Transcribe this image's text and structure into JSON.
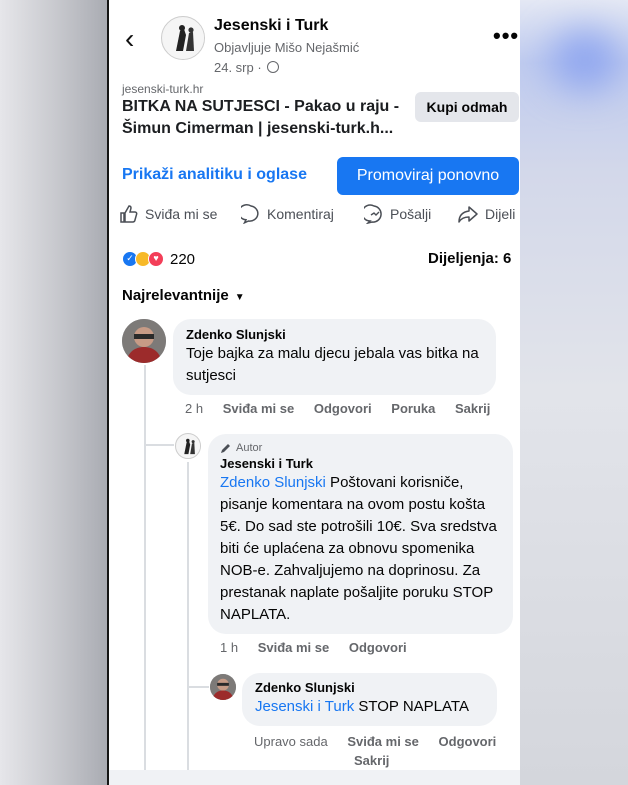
{
  "post_header": {
    "page_name": "Jesenski i Turk",
    "published_by": "Objavljuje Mišo Nejašmić",
    "date": "24. srp"
  },
  "link_preview": {
    "domain": "jesenski-turk.hr",
    "title": "BITKA NA SUTJESCI - Pakao u raju - Šimun Cimerman | jesenski-turk.h...",
    "cta": "Kupi odmah"
  },
  "admin": {
    "analytics": "Prikaži analitiku i oglase",
    "promote": "Promoviraj ponovno"
  },
  "actions": {
    "like": "Sviđa mi se",
    "comment": "Komentiraj",
    "send": "Pošalji",
    "share": "Dijeli"
  },
  "stats": {
    "reactions_count": "220",
    "shares": "Dijeljenja: 6"
  },
  "sort_label": "Najrelevantnije",
  "comments": [
    {
      "author": "Zdenko Slunjski",
      "text": "Toje bajka za malu djecu jebala vas bitka na sutjesci",
      "time": "2 h",
      "actions": [
        "Sviđa mi se",
        "Odgovori",
        "Poruka",
        "Sakrij"
      ]
    },
    {
      "badge": "Autor",
      "author": "Jesenski i Turk",
      "mention": "Zdenko Slunjski",
      "text": " Poštovani korisniče, pisanje komentara na ovom postu košta 5€. Do sad ste potrošili 10€. Sva sredstva biti će uplaćena za obnovu spomenika NOB-e. Zahvaljujemo na doprinosu. Za prestanak naplate pošaljite poruku STOP NAPLATA.",
      "time": "1 h",
      "actions": [
        "Sviđa mi se",
        "Odgovori"
      ]
    },
    {
      "author": "Zdenko Slunjski",
      "mention": "Jesenski i Turk",
      "text": " STOP NAPLATA",
      "time": "Upravo sada",
      "actions": [
        "Sviđa mi se",
        "Odgovori",
        "Sakrij"
      ]
    }
  ],
  "colors": {
    "accent": "#1877f2",
    "bubble": "#f0f2f5",
    "meta": "#65676b"
  }
}
